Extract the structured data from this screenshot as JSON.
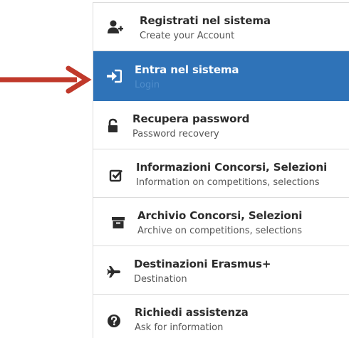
{
  "menu": {
    "items": [
      {
        "title": "Registrati nel sistema",
        "subtitle": "Create your Account",
        "icon": "user-plus-icon",
        "active": false
      },
      {
        "title": "Entra nel sistema",
        "subtitle": "Login",
        "icon": "sign-in-icon",
        "active": true
      },
      {
        "title": "Recupera password",
        "subtitle": "Password recovery",
        "icon": "unlock-icon",
        "active": false
      },
      {
        "title": "Informazioni Concorsi, Selezioni",
        "subtitle": "Information on competitions, selections",
        "icon": "checkbox-icon",
        "active": false
      },
      {
        "title": "Archivio Concorsi, Selezioni",
        "subtitle": "Archive on competitions, selections",
        "icon": "archive-icon",
        "active": false
      },
      {
        "title": "Destinazioni Erasmus+",
        "subtitle": "Destination",
        "icon": "plane-icon",
        "active": false
      },
      {
        "title": "Richiedi assistenza",
        "subtitle": "Ask for information",
        "icon": "question-circle-icon",
        "active": false
      }
    ]
  },
  "colors": {
    "active_bg": "#2f73b8",
    "active_subtitle": "#4f8dcb",
    "annotation_arrow": "#c0392b"
  },
  "annotation": {
    "icon": "red-arrow-icon"
  }
}
